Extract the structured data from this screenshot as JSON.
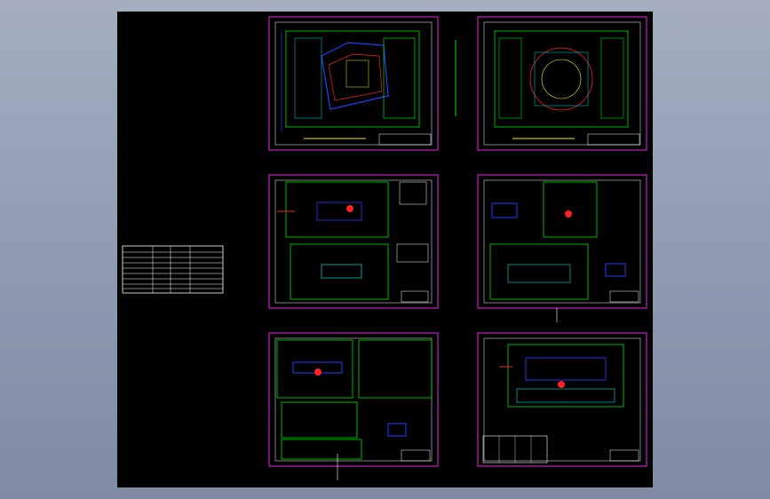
{
  "viewport": {
    "background": "#000000"
  },
  "colors": {
    "frame": "#c020c0",
    "green": "#00e000",
    "cyan": "#00e0e0",
    "white": "#ffffff",
    "red": "#ff2020",
    "blue": "#2040ff",
    "yellow": "#f0f000"
  },
  "sheets": [
    {
      "id": "plan-1",
      "kind": "site-plan"
    },
    {
      "id": "plan-2",
      "kind": "site-plan"
    },
    {
      "id": "section-1",
      "kind": "section"
    },
    {
      "id": "section-2",
      "kind": "section"
    },
    {
      "id": "section-3",
      "kind": "section"
    },
    {
      "id": "section-4",
      "kind": "section"
    }
  ],
  "index_table": {
    "rows": 8,
    "columns": 4
  }
}
